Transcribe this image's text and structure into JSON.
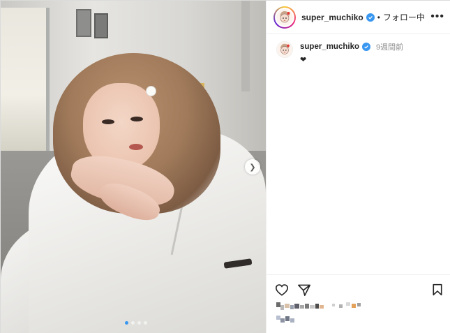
{
  "post": {
    "image_alt": "",
    "carousel": {
      "count": 4,
      "active_index": 0
    }
  },
  "header": {
    "username": "super_muchiko",
    "separator": "•",
    "follow_label": "フォロー中",
    "more_label": "•••"
  },
  "comment": {
    "username": "super_muchiko",
    "time": "9週間前",
    "caption": "❤"
  },
  "colors": {
    "verified": "#3897f0",
    "carousel_active": "#3897f0",
    "text": "#262626",
    "muted": "#8e8e8e"
  },
  "icons": {
    "like": "heart-icon",
    "share": "paper-plane-icon",
    "save": "bookmark-icon",
    "next": "chevron-right-icon",
    "verified": "verified-badge-icon"
  }
}
